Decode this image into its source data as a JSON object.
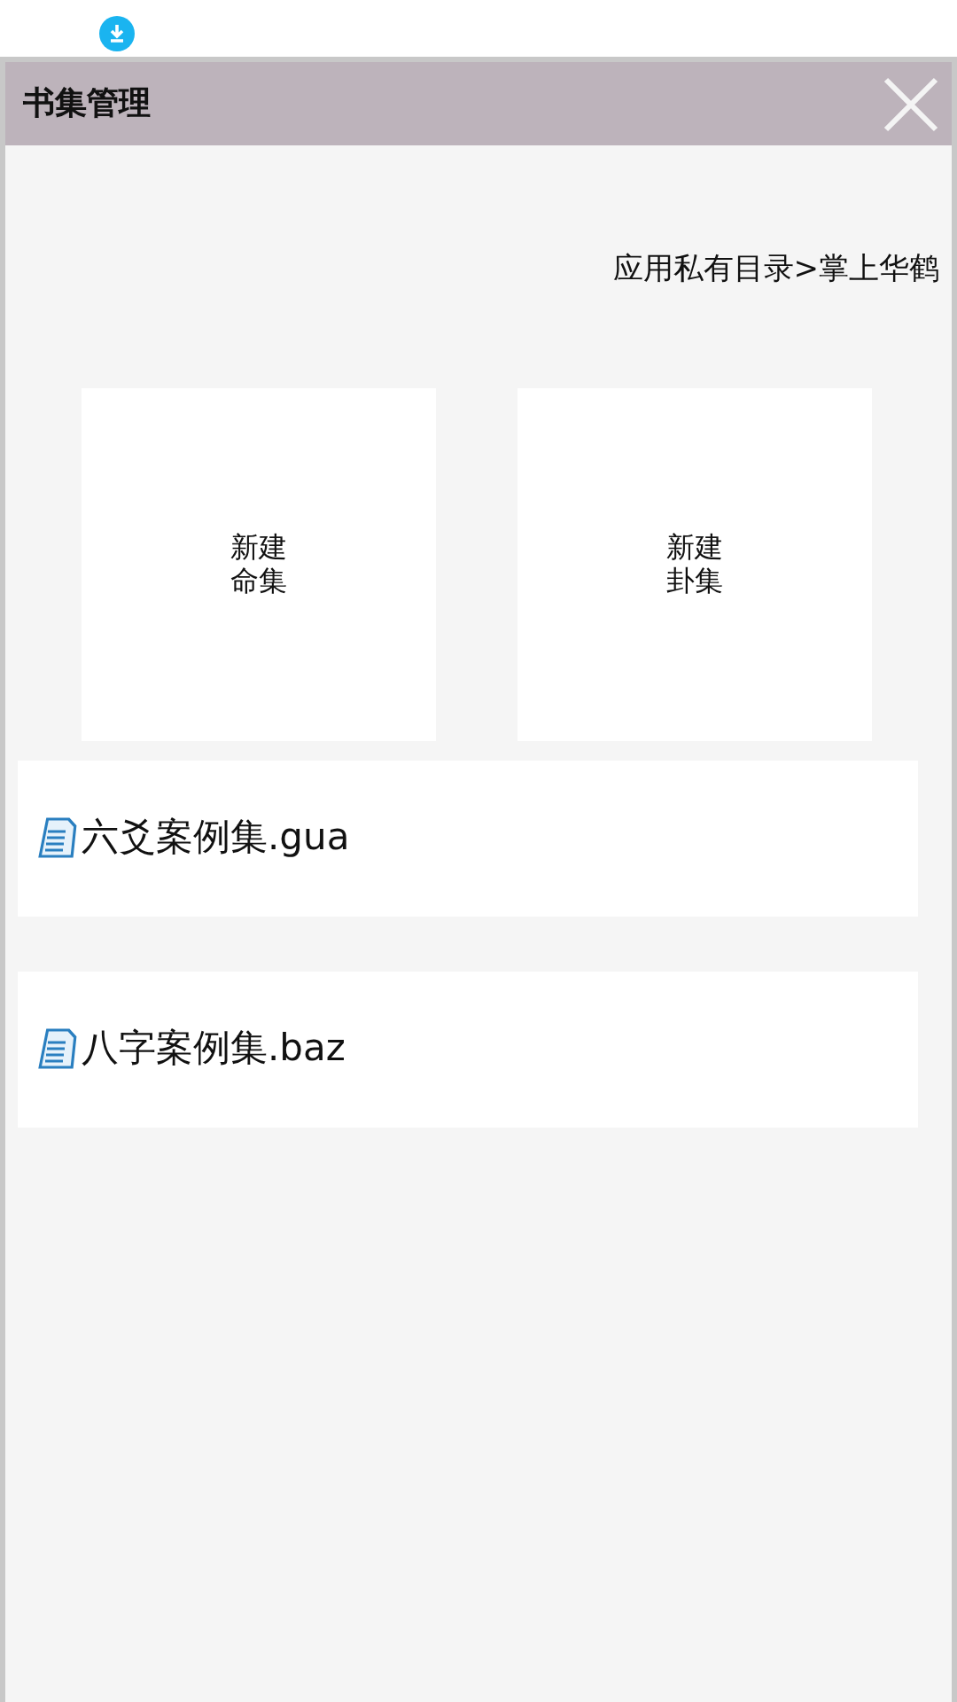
{
  "dialog": {
    "title": "书集管理",
    "path": "应用私有目录>掌上华鹤"
  },
  "tiles": [
    {
      "label": "新建命集"
    },
    {
      "label": "新建卦集"
    }
  ],
  "files": [
    {
      "name": "六爻案例集.gua"
    },
    {
      "name": "八字案例集.baz"
    }
  ]
}
